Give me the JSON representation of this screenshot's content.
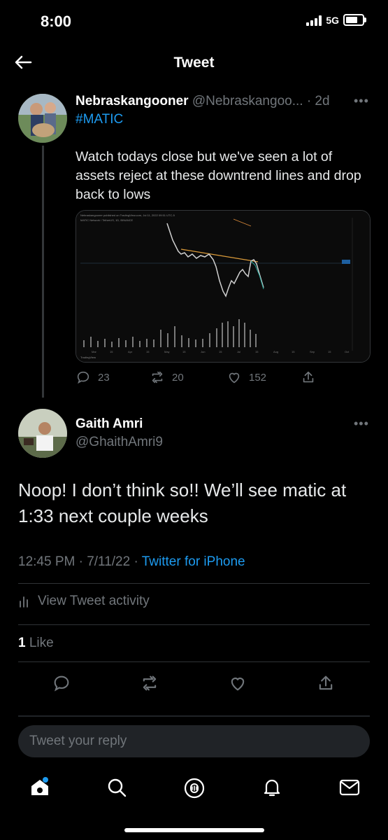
{
  "status": {
    "time": "8:00",
    "network": "5G"
  },
  "header": {
    "title": "Tweet"
  },
  "original_tweet": {
    "name": "Nebraskangooner",
    "handle": "@Nebraskangoo...",
    "time_ago": "· 2d",
    "hashtag": "#MATIC",
    "text": "Watch todays close but we've seen a lot of assets reject at these downtrend lines and drop back to lows",
    "chart_header": "Nebraskangooner published on TradingView.com, Jul 11, 2022 09:51 UTC-5",
    "chart_subtitle": "MATIC Network / TetherUS, 1D, BINANCE",
    "chart_x_labels": [
      "Mar",
      "15",
      "Apr",
      "15",
      "May",
      "15",
      "Jun",
      "15",
      "Jul",
      "15",
      "Aug",
      "15",
      "Sep",
      "15",
      "Oct"
    ],
    "chart_watermark": "TradingView",
    "replies": "23",
    "retweets": "20",
    "likes": "152"
  },
  "reply": {
    "name": "Gaith Amri",
    "handle": "@GhaithAmri9",
    "text": "Noop! I don’t think so!! We’ll see matic at 1:33 next couple weeks",
    "time": "12:45 PM · 7/11/22 ·",
    "source": "Twitter for iPhone",
    "activity": "View Tweet activity",
    "like_count": "1",
    "like_label": "Like"
  },
  "composer": {
    "placeholder": "Tweet your reply"
  },
  "colors": {
    "accent": "#1d9bf0",
    "muted": "#71767b",
    "background": "#000000"
  },
  "icons": [
    "back-arrow-icon",
    "more-icon",
    "reply-icon",
    "retweet-icon",
    "like-icon",
    "share-icon",
    "activity-icon",
    "home-icon",
    "search-icon",
    "spaces-icon",
    "notifications-icon",
    "messages-icon"
  ]
}
